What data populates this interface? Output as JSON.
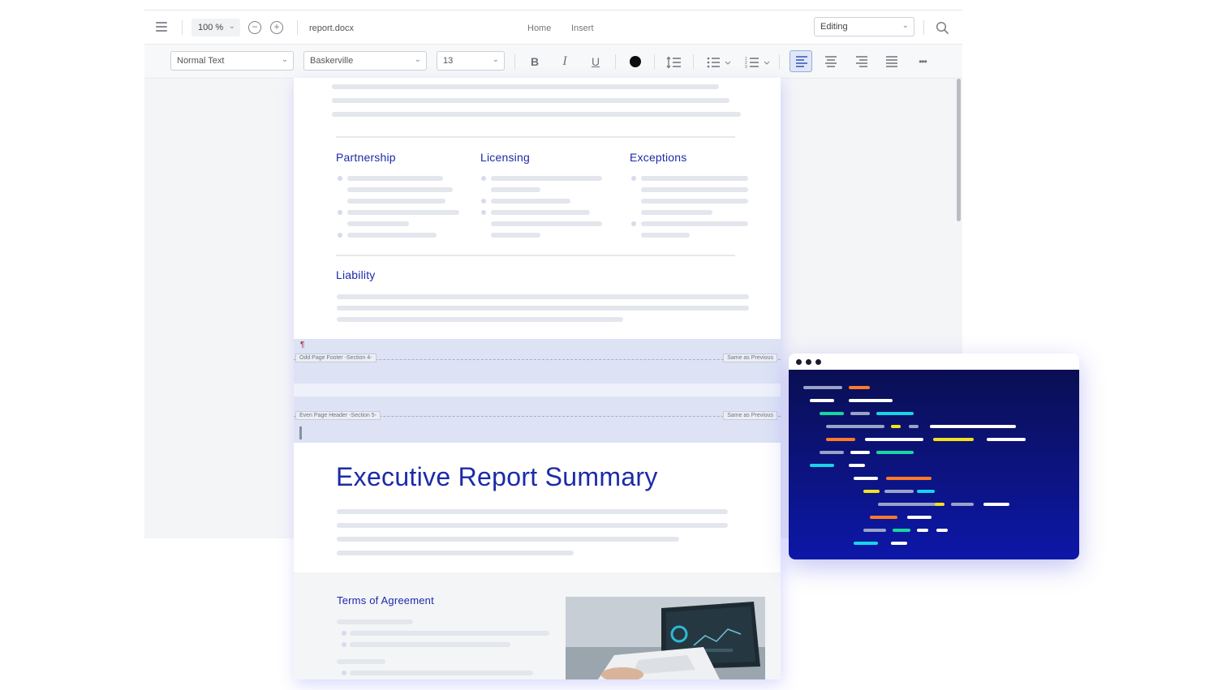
{
  "topbar": {
    "zoom": "100 %",
    "zoom_out_symbol": "−",
    "zoom_in_symbol": "+",
    "filename": "report.docx",
    "tabs": [
      "Home",
      "Insert"
    ],
    "mode": "Editing"
  },
  "toolbar": {
    "paragraph_style": "Normal Text",
    "font": "Baskerville",
    "font_size": "13",
    "bold": "B",
    "italic": "I",
    "underline": "U",
    "text_color": "#0d0d0d",
    "more": "•••"
  },
  "document": {
    "sections": {
      "partnership": "Partnership",
      "licensing": "Licensing",
      "exceptions": "Exceptions",
      "liability": "Liability"
    },
    "footer_band": {
      "marker": "¶",
      "label": "Odd Page Footer -Section 4-",
      "same_as_previous": "Same as Previous"
    },
    "header_band": {
      "label": "Even Page Header -Section 5-",
      "same_as_previous": "Same as Previous"
    },
    "title": "Executive Report Summary",
    "terms_heading": "Terms of Agreement"
  },
  "colors": {
    "accent": "#1c2aa8",
    "code_bg_top": "#0a0f52",
    "code_bg_bottom": "#0d17a8",
    "code_orange": "#ff7a29",
    "code_cyan": "#19d3e6",
    "code_green": "#16d7a2",
    "code_yellow": "#f2e11f",
    "code_gray": "#9aa3c7",
    "code_white": "#ffffff"
  },
  "icons": {
    "menu": "hamburger-icon",
    "zoom_out": "minus-circle-icon",
    "zoom_in": "plus-circle-icon",
    "search": "search-icon",
    "line_spacing": "line-spacing-icon",
    "bullets": "bullet-list-icon",
    "numbering": "numbered-list-icon",
    "align_left": "align-left-icon",
    "align_center": "align-center-icon",
    "align_right": "align-right-icon",
    "justify": "justify-icon"
  }
}
